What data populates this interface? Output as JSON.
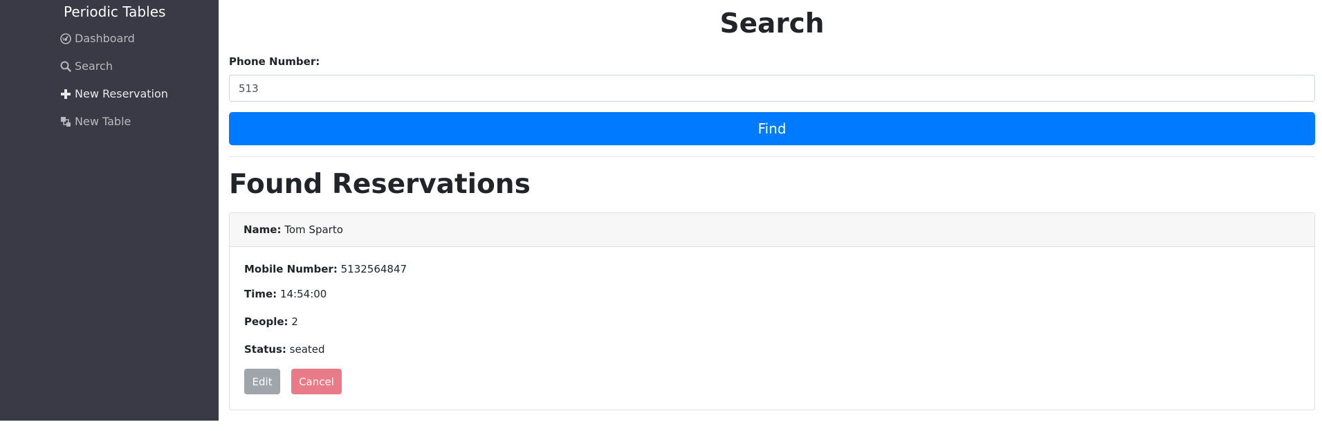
{
  "sidebar": {
    "brand": "Periodic Tables",
    "items": [
      {
        "label": "Dashboard",
        "icon": "dashboard-icon"
      },
      {
        "label": "Search",
        "icon": "search-icon"
      },
      {
        "label": "New Reservation",
        "icon": "plus-icon"
      },
      {
        "label": "New Table",
        "icon": "layers-icon"
      }
    ]
  },
  "search": {
    "title": "Search",
    "phone_label": "Phone Number:",
    "phone_value": "513",
    "find_label": "Find"
  },
  "results": {
    "title": "Found Reservations",
    "reservations": [
      {
        "name_label": "Name:",
        "name": "Tom Sparto",
        "mobile_label": "Mobile Number:",
        "mobile": "5132564847",
        "time_label": "Time:",
        "time": "14:54:00",
        "people_label": "People:",
        "people": "2",
        "status_label": "Status:",
        "status": "seated",
        "edit_label": "Edit",
        "cancel_label": "Cancel"
      }
    ]
  },
  "colors": {
    "sidebar_bg": "#393a45",
    "primary": "#007bff",
    "secondary": "#9fa5ab",
    "danger": "#e87b87"
  }
}
